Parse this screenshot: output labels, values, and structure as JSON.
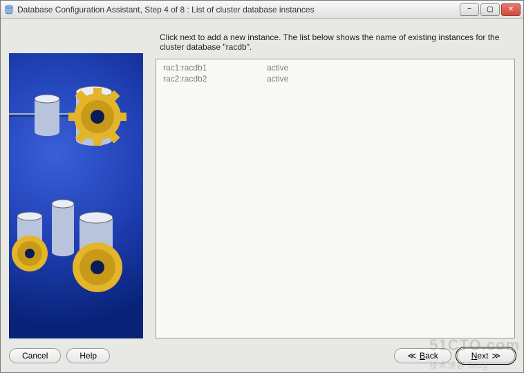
{
  "window": {
    "title": "Database Configuration Assistant, Step 4 of 8 : List of cluster database instances"
  },
  "titlebar_icons": {
    "app": "db-cylinder-icon",
    "min": "−",
    "max": "▢",
    "close": "✕"
  },
  "content": {
    "instruction": "Click next to add a new instance. The list below shows the name of existing instances for the cluster database \"racdb\".",
    "instances": [
      {
        "node_instance": "rac1:racdb1",
        "status": "active"
      },
      {
        "node_instance": "rac2:racdb2",
        "status": "active"
      }
    ]
  },
  "buttons": {
    "cancel": "Cancel",
    "help": "Help",
    "back": "Back",
    "next": "Next"
  },
  "nav_glyphs": {
    "back": "≪",
    "next": "≫"
  },
  "watermark": {
    "main": "51CTO.com",
    "sub": "技术博客  Blog"
  }
}
